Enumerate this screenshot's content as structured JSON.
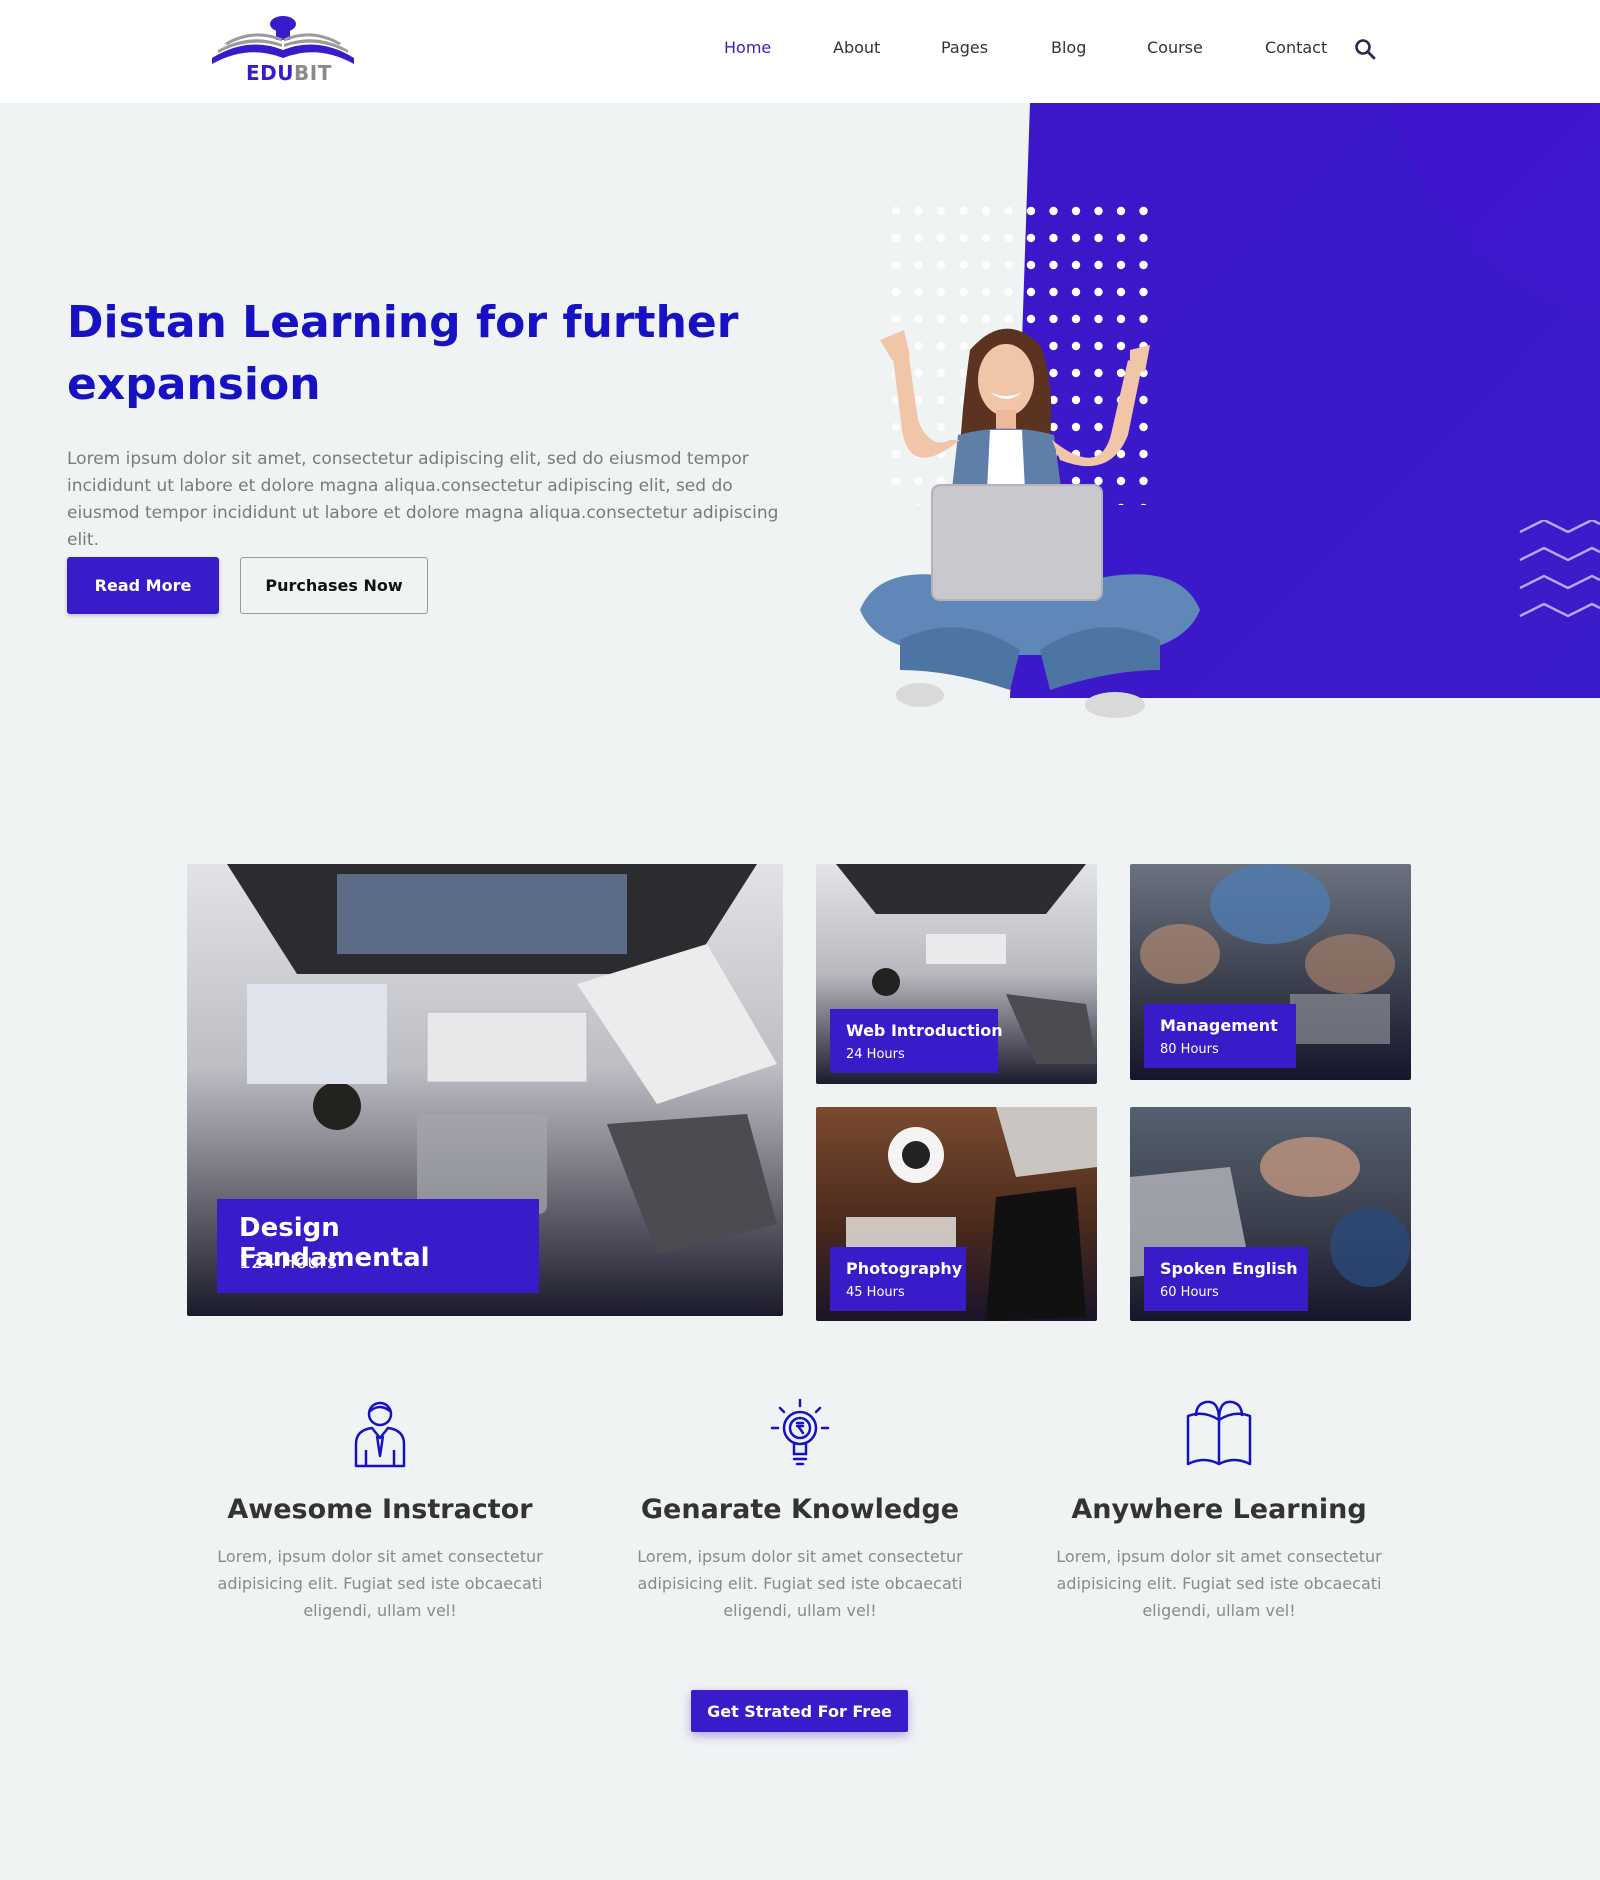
{
  "brand": {
    "logo_edu": "EDU",
    "logo_bit": "BIT"
  },
  "nav": {
    "items": [
      {
        "label": "Home",
        "active": true
      },
      {
        "label": "About"
      },
      {
        "label": "Pages"
      },
      {
        "label": "Blog"
      },
      {
        "label": "Course"
      },
      {
        "label": "Contact"
      }
    ],
    "search_icon": "search-icon"
  },
  "hero": {
    "title": "Distan Learning for further expansion",
    "text": "Lorem ipsum dolor sit amet, consectetur adipiscing elit, sed do eiusmod tempor incididunt ut labore et dolore magna aliqua.consectetur adipiscing elit, sed do eiusmod tempor incididunt ut labore et dolore magna aliqua.consectetur adipiscing elit.",
    "primary_button": "Read More",
    "secondary_button": "Purchases Now"
  },
  "courses": [
    {
      "title": "Design Fandamental",
      "hours": "124 Hours"
    },
    {
      "title": "Web Introduction",
      "hours": "24 Hours"
    },
    {
      "title": "Management",
      "hours": "80 Hours"
    },
    {
      "title": "Photography",
      "hours": "45 Hours"
    },
    {
      "title": "Spoken English",
      "hours": "60 Hours"
    }
  ],
  "features": [
    {
      "icon": "instructor-icon",
      "title": "Awesome Instractor",
      "text": "Lorem, ipsum dolor sit amet consectetur adipisicing elit. Fugiat sed iste obcaecati eligendi, ullam vel!"
    },
    {
      "icon": "lightbulb-icon",
      "title": "Genarate Knowledge",
      "text": "Lorem, ipsum dolor sit amet consectetur adipisicing elit. Fugiat sed iste obcaecati eligendi, ullam vel!"
    },
    {
      "icon": "open-book-icon",
      "title": "Anywhere Learning",
      "text": "Lorem, ipsum dolor sit amet consectetur adipisicing elit. Fugiat sed iste obcaecati eligendi, ullam vel!"
    }
  ],
  "cta": {
    "label": "Get Strated For Free"
  },
  "colors": {
    "accent": "#3a1bc9",
    "hero_title": "#1711c4",
    "background": "#f0f3f4"
  }
}
